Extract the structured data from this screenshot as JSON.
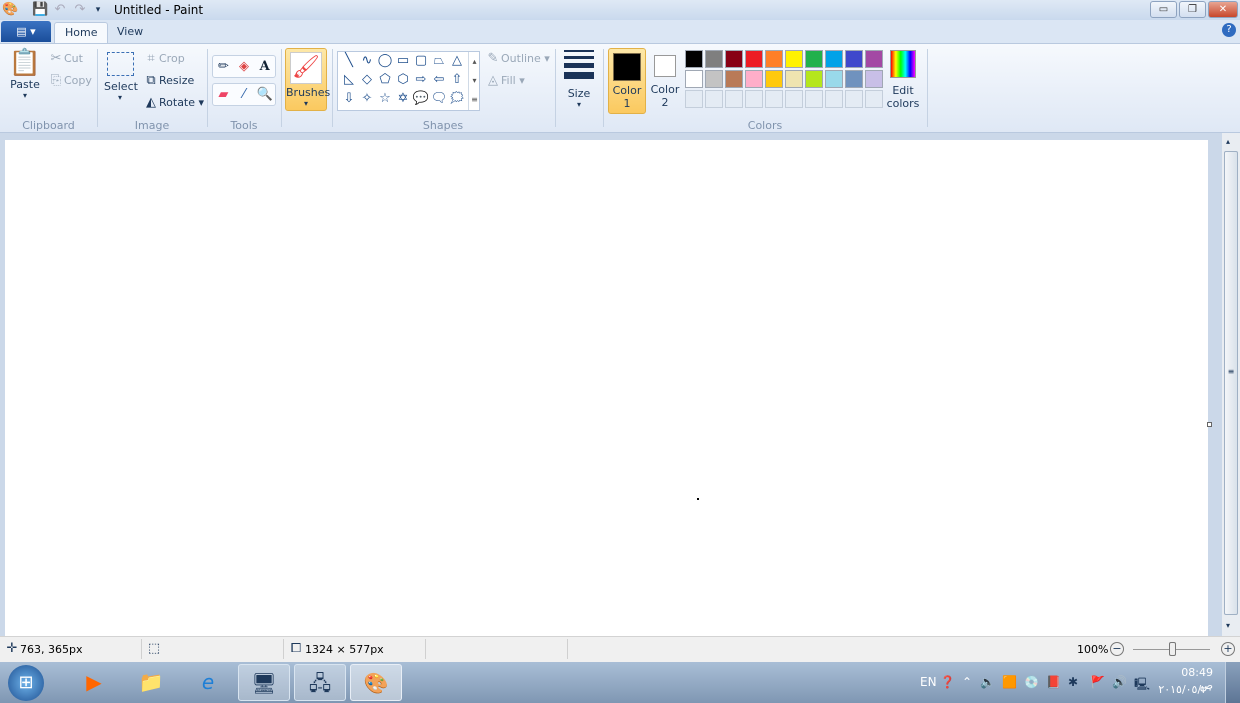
{
  "window": {
    "title": "Untitled - Paint",
    "minimize": "▭",
    "restore": "❐",
    "close": "✕"
  },
  "tabs": [
    {
      "label": "Home"
    },
    {
      "label": "View"
    }
  ],
  "clipboard": {
    "group": "Clipboard",
    "paste": "Paste",
    "cut": "Cut",
    "copy": "Copy"
  },
  "image": {
    "group": "Image",
    "select": "Select",
    "crop": "Crop",
    "resize": "Resize",
    "rotate": "Rotate"
  },
  "tools": {
    "group": "Tools"
  },
  "brushes": {
    "label": "Brushes"
  },
  "shapes": {
    "group": "Shapes",
    "outline": "Outline",
    "fill": "Fill",
    "glyphs": [
      "╲",
      "∿",
      "◯",
      "▭",
      "▢",
      "⏢",
      "△",
      "◺",
      "◇",
      "⬠",
      "⬡",
      "⇨",
      "⇦",
      "⇧",
      "⇩",
      "✧",
      "☆",
      "✡",
      "💬",
      "🗨",
      "🗯"
    ]
  },
  "size": {
    "label": "Size"
  },
  "colors": {
    "group": "Colors",
    "color1": "Color",
    "color1_num": "1",
    "color2": "Color",
    "color2_num": "2",
    "edit": "Edit",
    "edit2": "colors",
    "color1_value": "#000000",
    "color2_value": "#ffffff",
    "row1": [
      "#000000",
      "#7f7f7f",
      "#880015",
      "#ed1c24",
      "#ff7f27",
      "#fff200",
      "#22b14c",
      "#00a2e8",
      "#3f48cc",
      "#a349a4"
    ],
    "row2": [
      "#ffffff",
      "#c3c3c3",
      "#b97a57",
      "#ffaec9",
      "#ffc90e",
      "#efe4b0",
      "#b5e61d",
      "#99d9ea",
      "#7092be",
      "#c8bfe7"
    ]
  },
  "status": {
    "cursor": "763, 365px",
    "image_size": "1324 × 577px",
    "zoom": "100%",
    "zoom_level": 100
  },
  "taskbar": {
    "lang": "EN",
    "time": "08:49 ص",
    "date": "٢٠١٥/٠٥/٢٠"
  }
}
